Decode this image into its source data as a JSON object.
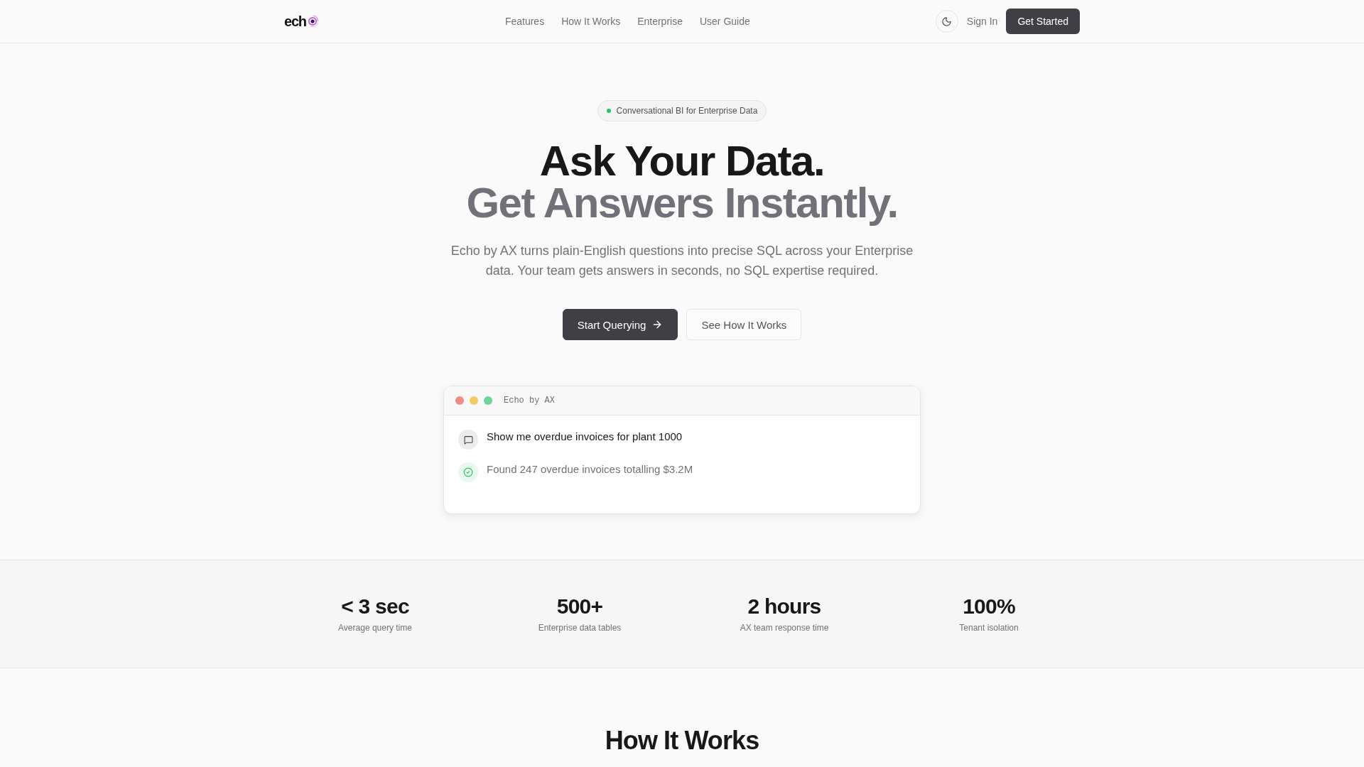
{
  "nav": {
    "logo": {
      "text": "ech"
    },
    "links": [
      {
        "label": "Features"
      },
      {
        "label": "How It Works"
      },
      {
        "label": "Enterprise"
      },
      {
        "label": "User Guide"
      }
    ],
    "sign_in": "Sign In",
    "cta": "Get Started"
  },
  "hero": {
    "badge": "Conversational BI for Enterprise Data",
    "title_line_1": "Ask Your Data.",
    "title_line_2": "Get Answers Instantly.",
    "description": "Echo by AX turns plain-English questions into precise SQL across your Enterprise data. Your team gets answers in seconds, no SQL expertise required.",
    "buttons": [
      {
        "label": "Start Querying",
        "kind": "primary"
      },
      {
        "label": "See How It Works",
        "kind": "secondary"
      }
    ]
  },
  "demo_window": {
    "title": "Echo by AX",
    "messages": [
      {
        "kind": "question",
        "text": "Show me overdue invoices for plant 1000"
      },
      {
        "kind": "answer",
        "text": "Found 247 overdue invoices totalling $3.2M"
      }
    ]
  },
  "stats": [
    {
      "value": "< 3 sec",
      "label": "Average query time"
    },
    {
      "value": "500+",
      "label": "Enterprise data tables"
    },
    {
      "value": "2 hours",
      "label": "AX team response time"
    },
    {
      "value": "100%",
      "label": "Tenant isolation"
    }
  ],
  "how_it_works": {
    "title": "How It Works"
  }
}
